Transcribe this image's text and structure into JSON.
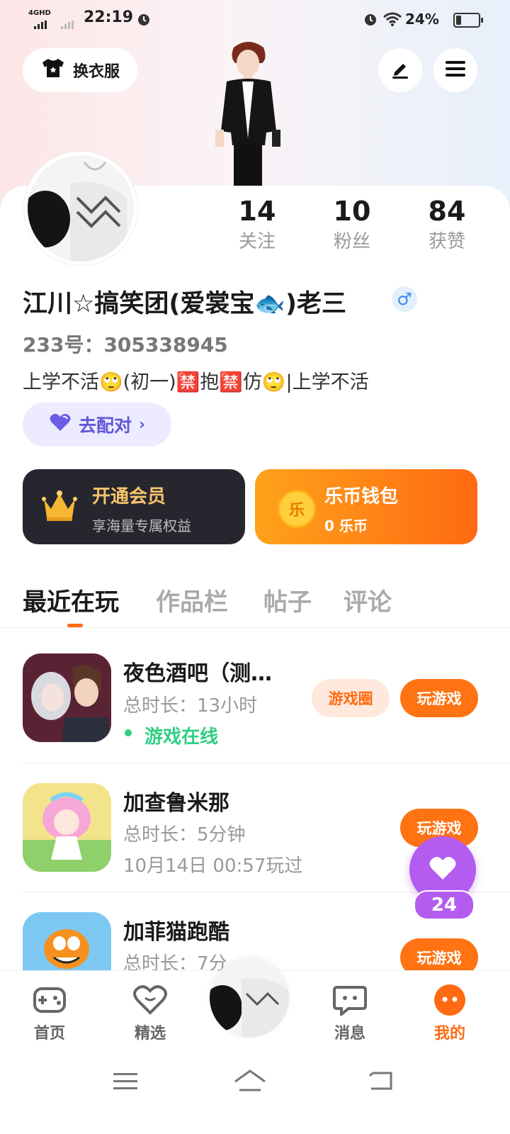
{
  "status_bar": {
    "network": "4GHD",
    "time": "22:19",
    "battery": "24%"
  },
  "header": {
    "outfit_label": "换衣服"
  },
  "profile": {
    "stats": [
      {
        "value": "14",
        "label": "关注"
      },
      {
        "value": "10",
        "label": "粉丝"
      },
      {
        "value": "84",
        "label": "获赞"
      }
    ],
    "name": "江川☆搞笑团(爱裳宝🐟)老三",
    "gender": "♂",
    "uid": "233号：305338945",
    "bio": "上学不活🙄(初一)🈲抱🈲仿🙄|上学不活",
    "match_label": "去配对"
  },
  "vip": {
    "title": "开通会员",
    "subtitle": "享海量专属权益"
  },
  "wallet": {
    "title": "乐币钱包",
    "subtitle": "0 乐币",
    "coin_char": "乐"
  },
  "tabs": [
    "最近在玩",
    "作品栏",
    "帖子",
    "评论"
  ],
  "games": [
    {
      "title": "夜色酒吧（测…",
      "duration": "总时长：13小时",
      "status": "游戏在线",
      "circle_label": "游戏圈",
      "play_label": "玩游戏"
    },
    {
      "title": "加查鲁米那",
      "duration": "总时长：5分钟",
      "status": "10月14日 00:57玩过",
      "play_label": "玩游戏"
    },
    {
      "title": "加菲猫跑酷",
      "duration": "总时长：7分",
      "play_label": "玩游戏"
    }
  ],
  "fab": {
    "count": "24"
  },
  "bottom_nav": [
    {
      "label": "首页",
      "icon": "gamepad-icon"
    },
    {
      "label": "精选",
      "icon": "heart-chat-icon"
    },
    {
      "label": "",
      "icon": "avatar"
    },
    {
      "label": "消息",
      "icon": "message-icon"
    },
    {
      "label": "我的",
      "icon": "me-icon"
    }
  ],
  "colors": {
    "accent": "#ff6a12",
    "purple": "#b45cf0",
    "online": "#2fcf82"
  }
}
